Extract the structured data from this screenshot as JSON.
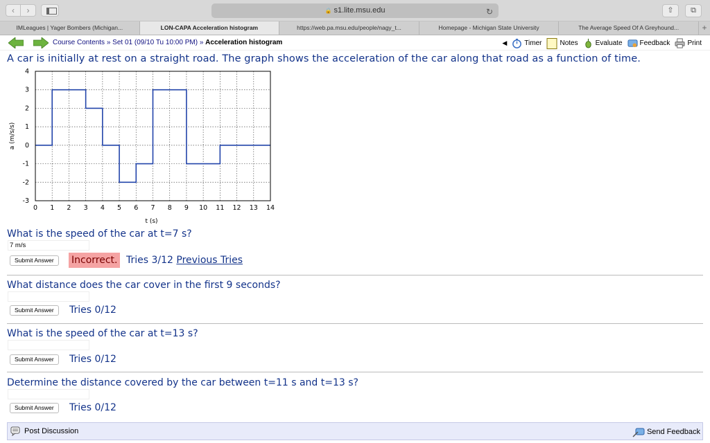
{
  "browser": {
    "url": "s1.lite.msu.edu",
    "tabs": [
      {
        "label": "IMLeagues | Yager Bombers (Michigan...",
        "active": false
      },
      {
        "label": "LON-CAPA Acceleration histogram",
        "active": true
      },
      {
        "label": "https://web.pa.msu.edu/people/nagy_t...",
        "active": false
      },
      {
        "label": "Homepage - Michigan State University",
        "active": false
      },
      {
        "label": "The Average Speed Of A Greyhound...",
        "active": false
      }
    ]
  },
  "lonbar": {
    "crumb_course": "Course Contents",
    "crumb_sep": "»",
    "crumb_set": "Set 01 (09/10 Tu 10:00 PM)",
    "crumb_current": "Acceleration histogram",
    "timer": "Timer",
    "notes": "Notes",
    "evaluate": "Evaluate",
    "feedback": "Feedback",
    "print": "Print"
  },
  "problem_text": "A car is initially at rest on a straight road. The graph shows the acceleration of the car along that road as a function of time.",
  "chart_data": {
    "type": "line",
    "step": true,
    "xlabel": "t (s)",
    "ylabel": "a (m/s/s)",
    "xlim": [
      0,
      14
    ],
    "ylim": [
      -3,
      4
    ],
    "xticks": [
      0,
      1,
      2,
      3,
      4,
      5,
      6,
      7,
      8,
      9,
      10,
      11,
      12,
      13,
      14
    ],
    "yticks": [
      -3,
      -2,
      -1,
      0,
      1,
      2,
      3,
      4
    ],
    "grid": true,
    "color": "#2244aa",
    "segments": [
      {
        "t0": 0,
        "t1": 1,
        "a": 0
      },
      {
        "t0": 1,
        "t1": 3,
        "a": 3
      },
      {
        "t0": 3,
        "t1": 4,
        "a": 2
      },
      {
        "t0": 4,
        "t1": 5,
        "a": 0
      },
      {
        "t0": 5,
        "t1": 6,
        "a": -2
      },
      {
        "t0": 6,
        "t1": 7,
        "a": -1
      },
      {
        "t0": 7,
        "t1": 9,
        "a": 3
      },
      {
        "t0": 9,
        "t1": 11,
        "a": -1
      },
      {
        "t0": 11,
        "t1": 14,
        "a": 0
      }
    ]
  },
  "questions": [
    {
      "text": "What is the speed of the car at t=7 s?",
      "answer": "7 m/s",
      "submit": "Submit Answer",
      "status": "Incorrect.",
      "tries": "Tries 3/12",
      "prev": "Previous Tries"
    },
    {
      "text": "What distance does the car cover in the first 9 seconds?",
      "answer": "",
      "submit": "Submit Answer",
      "tries": "Tries 0/12"
    },
    {
      "text": "What is the speed of the car at t=13 s?",
      "answer": "",
      "submit": "Submit Answer",
      "tries": "Tries 0/12"
    },
    {
      "text": "Determine the distance covered by the car between t=11 s and t=13 s?",
      "answer": "",
      "submit": "Submit Answer",
      "tries": "Tries 0/12"
    }
  ],
  "footer": {
    "post_discussion": "Post Discussion",
    "send_feedback": "Send Feedback"
  }
}
